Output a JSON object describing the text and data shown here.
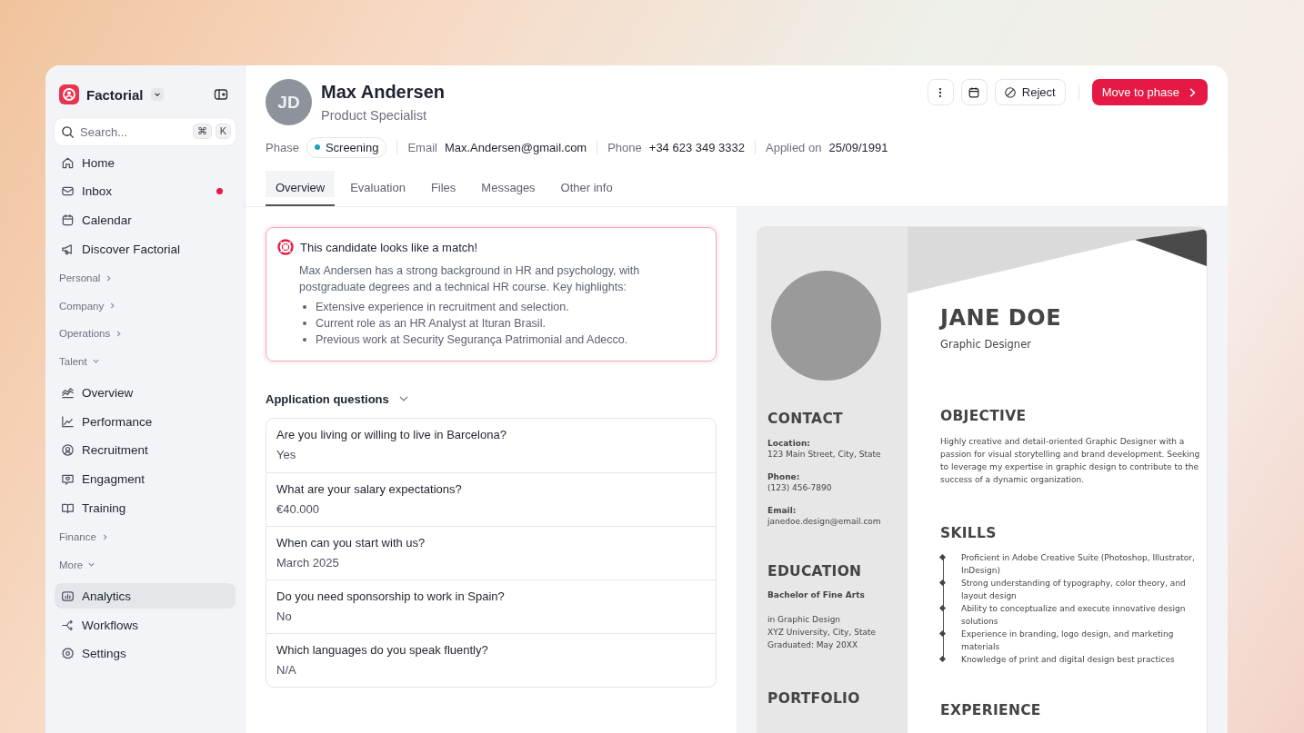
{
  "sidebar": {
    "brand": "Factorial",
    "search": {
      "placeholder": "Search...",
      "shortcut": [
        "⌘",
        "K"
      ]
    },
    "items": [
      {
        "label": "Home",
        "selected": false,
        "unread": false
      },
      {
        "label": "Inbox",
        "selected": false,
        "unread": true
      },
      {
        "label": "Calendar",
        "selected": false,
        "unread": false
      },
      {
        "label": "Discover Factorial",
        "selected": false,
        "unread": false
      }
    ],
    "sections": [
      {
        "label": "Personal",
        "expanded": false
      },
      {
        "label": "Company",
        "expanded": false
      },
      {
        "label": "Operations",
        "expanded": false
      },
      {
        "label": "Talent",
        "expanded": true,
        "items": [
          {
            "label": "Overview",
            "selected": false
          },
          {
            "label": "Performance",
            "selected": false
          },
          {
            "label": "Recruitment",
            "selected": false
          },
          {
            "label": "Engagment",
            "selected": false
          },
          {
            "label": "Training",
            "selected": false
          }
        ]
      },
      {
        "label": "Finance",
        "expanded": false
      },
      {
        "label": "More",
        "expanded": true,
        "items": [
          {
            "label": "Analytics",
            "selected": true
          },
          {
            "label": "Workflows",
            "selected": false
          },
          {
            "label": "Settings",
            "selected": false
          }
        ]
      }
    ]
  },
  "candidate": {
    "initials": "JD",
    "name": "Max Andersen",
    "role": "Product Specialist"
  },
  "actions": {
    "reject": "Reject",
    "primary": "Move to phase"
  },
  "meta": {
    "phase_label": "Phase",
    "phase": "Screening",
    "email_label": "Email",
    "email": "Max.Andersen@gmail.com",
    "phone_label": "Phone",
    "phone": "+34 623 349 3332",
    "applied_label": "Applied on",
    "applied": "25/09/1991"
  },
  "tabs": [
    {
      "label": "Overview",
      "selected": true
    },
    {
      "label": "Evaluation",
      "selected": false
    },
    {
      "label": "Files",
      "selected": false
    },
    {
      "label": "Messages",
      "selected": false
    },
    {
      "label": "Other info",
      "selected": false
    }
  ],
  "match": {
    "title": "This candidate looks like a match!",
    "text": "Max Andersen has a strong background in HR and psychology, with postgraduate degrees and a technical HR course. Key highlights:",
    "highlights": [
      "Extensive experience in recruitment and selection.",
      "Current role as an HR Analyst at Ituran Brasil.",
      "Previous work at Security Segurança Patrimonial and Adecco."
    ]
  },
  "questions": {
    "title": "Application questions",
    "expanded": true,
    "items": [
      {
        "question": "Are you living or willing to live in Barcelona?",
        "answer": "Yes"
      },
      {
        "question": "What are your salary expectations?",
        "answer": "€40.000"
      },
      {
        "question": "When can you start with us?",
        "answer": "March 2025"
      },
      {
        "question": "Do you need sponsorship to work in Spain?",
        "answer": "No"
      },
      {
        "question": "Which languages do you speak fluently?",
        "answer": "N/A"
      }
    ]
  },
  "resume": {
    "name": "JANE DOE",
    "title": "Graphic Designer",
    "contact_heading": "CONTACT",
    "contact": [
      {
        "label": "Location:",
        "value": "123 Main Street, City, State"
      },
      {
        "label": "Phone:",
        "value": "(123) 456-7890"
      },
      {
        "label": "Email:",
        "value": "janedoe.design@email.com"
      }
    ],
    "education_heading": "EDUCATION",
    "degree": "Bachelor of Fine Arts",
    "education_lines": [
      "in Graphic Design",
      "XYZ University, City, State",
      "Graduated: May 20XX"
    ],
    "portfolio_heading": "PORTFOLIO",
    "objective_heading": "OBJECTIVE",
    "objective": "Highly creative and detail-oriented Graphic Designer with a passion for visual storytelling and brand development. Seeking to leverage my expertise in graphic design to contribute to the success of a dynamic organization.",
    "skills_heading": "SKILLS",
    "skills": [
      "Proficient in Adobe Creative Suite (Photoshop, Illustrator, InDesign)",
      "Strong understanding of typography, color theory, and layout design",
      "Ability to conceptualize and execute innovative design solutions",
      "Experience in branding, logo design, and marketing materials",
      "Knowledge of print and digital design best practices"
    ],
    "experience_heading": "EXPERIENCE"
  }
}
